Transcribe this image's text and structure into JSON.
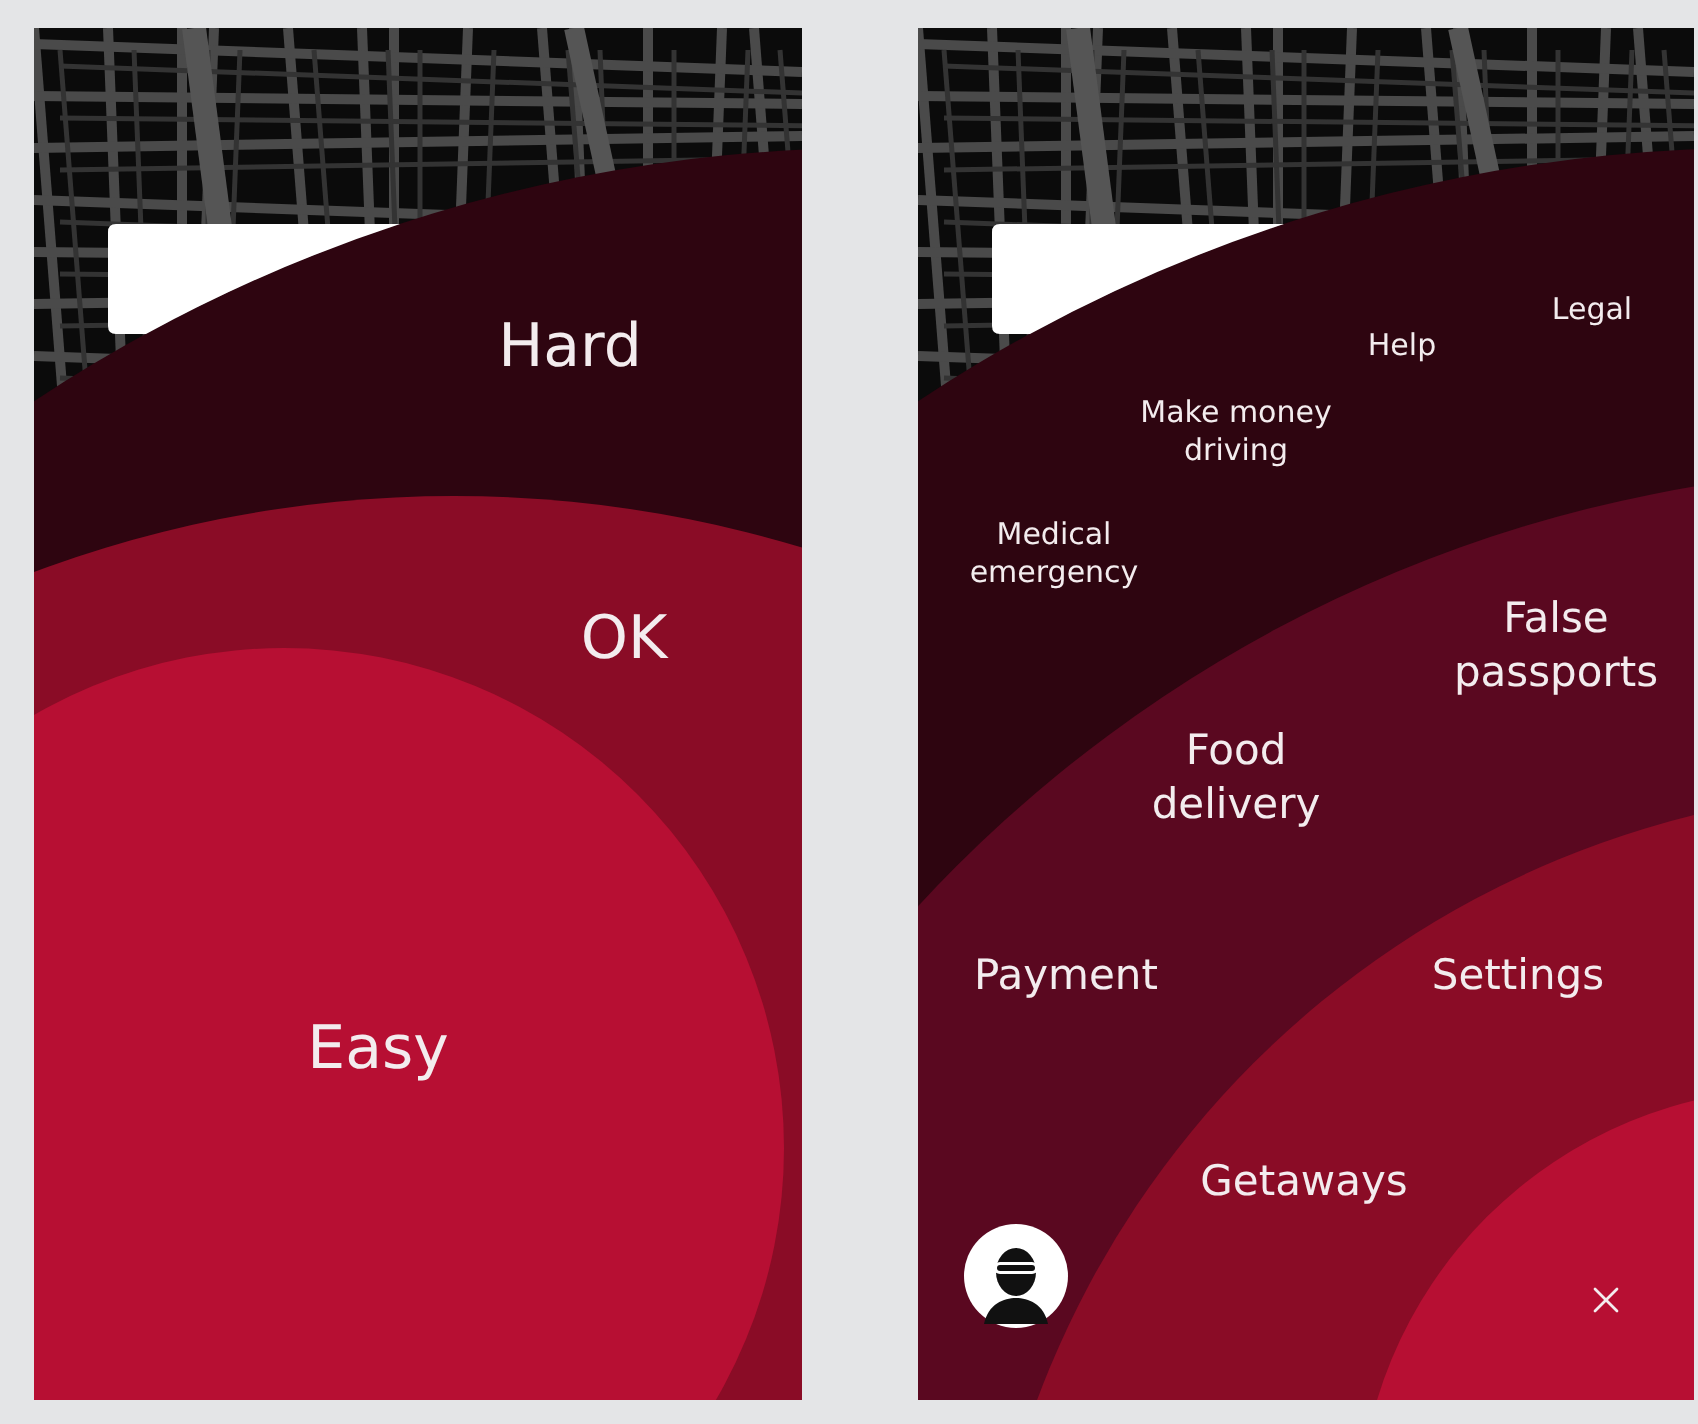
{
  "screens": [
    {
      "kind": "difficulty",
      "labels": [
        {
          "text": "Hard",
          "kind": "large"
        },
        {
          "text": "OK",
          "kind": "large"
        },
        {
          "text": "Easy",
          "kind": "large"
        }
      ]
    },
    {
      "kind": "menu",
      "labels": [
        {
          "text": "Legal",
          "kind": "small"
        },
        {
          "text": "Help",
          "kind": "small"
        },
        {
          "text": "Make money\ndriving",
          "kind": "small"
        },
        {
          "text": "Medical\nemergency",
          "kind": "small"
        },
        {
          "text": "False\npassports",
          "kind": "medium"
        },
        {
          "text": "Food\ndelivery",
          "kind": "medium"
        },
        {
          "text": "Payment",
          "kind": "medium"
        },
        {
          "text": "Settings",
          "kind": "medium"
        },
        {
          "text": "Getaways",
          "kind": "medium"
        }
      ],
      "avatar": true,
      "close": true
    }
  ]
}
